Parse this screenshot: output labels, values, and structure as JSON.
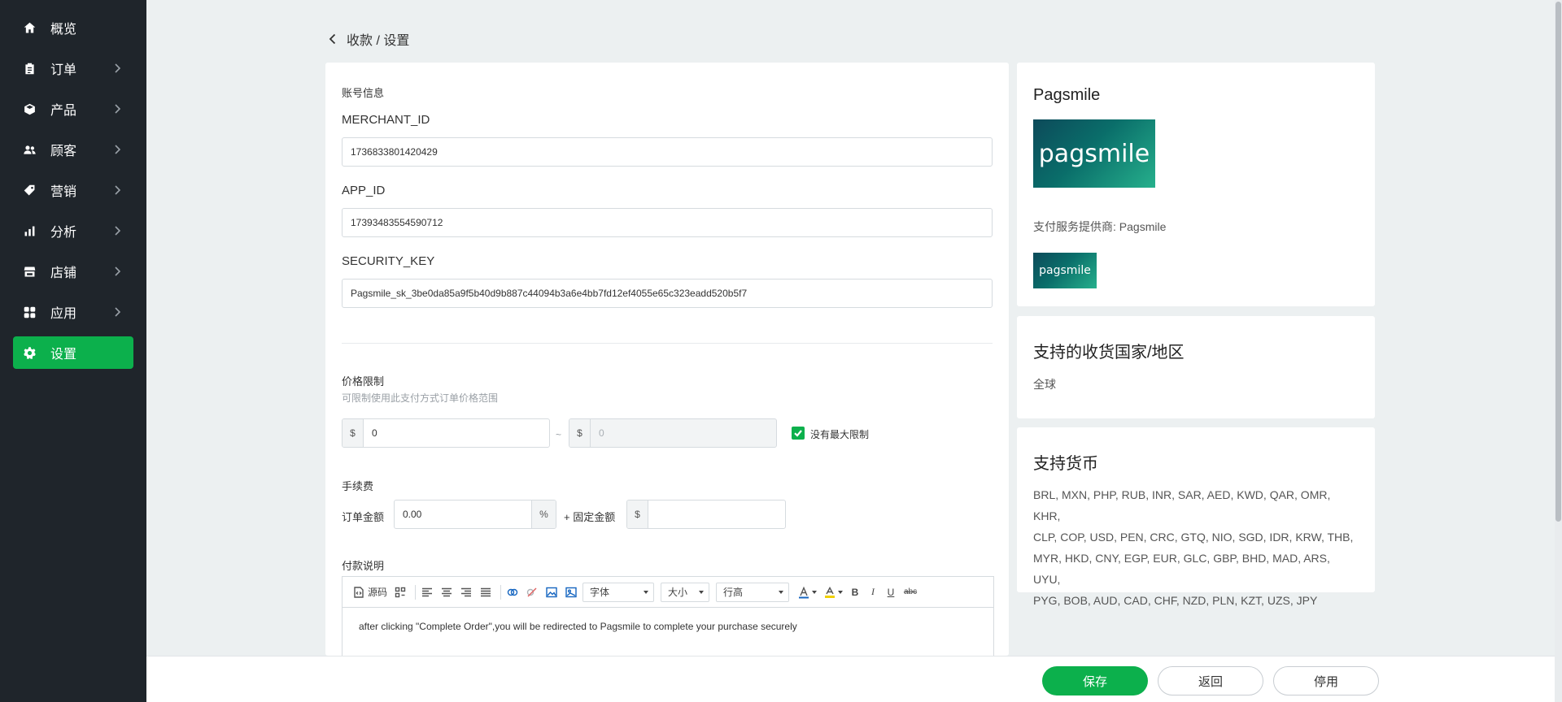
{
  "sidebar": {
    "items": [
      {
        "label": "概览",
        "icon": "home-icon",
        "has_arrow": false
      },
      {
        "label": "订单",
        "icon": "clipboard-icon",
        "has_arrow": true
      },
      {
        "label": "产品",
        "icon": "box-icon",
        "has_arrow": true
      },
      {
        "label": "顾客",
        "icon": "users-icon",
        "has_arrow": true
      },
      {
        "label": "营销",
        "icon": "tag-icon",
        "has_arrow": true
      },
      {
        "label": "分析",
        "icon": "bar-chart-icon",
        "has_arrow": true
      },
      {
        "label": "店铺",
        "icon": "store-icon",
        "has_arrow": true
      },
      {
        "label": "应用",
        "icon": "apps-icon",
        "has_arrow": true
      },
      {
        "label": "设置",
        "icon": "gear-icon",
        "has_arrow": false,
        "active": true
      }
    ]
  },
  "breadcrumb": {
    "text": "收款 / 设置"
  },
  "account": {
    "section_title": "账号信息",
    "merchant_id_label": "MERCHANT_ID",
    "merchant_id_value": "1736833801420429",
    "app_id_label": "APP_ID",
    "app_id_value": "17393483554590712",
    "security_key_label": "SECURITY_KEY",
    "security_key_value": "Pagsmile_sk_3be0da85a9f5b40d9b887c44094b3a6e4bb7fd12ef4055e65c323eadd520b5f7"
  },
  "price_limit": {
    "title": "价格限制",
    "hint": "可限制使用此支付方式订单价格范围",
    "currency_symbol": "$",
    "min_value": "0",
    "separator": "~",
    "max_placeholder": "0",
    "no_max_label": "没有最大限制",
    "no_max_checked": true
  },
  "fee": {
    "title": "手续费",
    "order_amount_label": "订单金额",
    "percent_value": "0.00",
    "percent_symbol": "%",
    "fixed_amount_label": "+ 固定金额",
    "currency_symbol": "$",
    "fixed_value": ""
  },
  "payment_desc": {
    "title": "付款说明",
    "toolbar": {
      "source_label": "源码",
      "font_label": "字体",
      "size_label": "大小",
      "line_height_label": "行高",
      "bold": "B",
      "italic": "I",
      "underline": "U",
      "strike": "abc"
    },
    "content": "after clicking \"Complete Order\",you will be redirected to Pagsmile to complete your purchase securely"
  },
  "provider_card": {
    "title": "Pagsmile",
    "logo_text": "pagsmile",
    "provider_text": "支付服务提供商: Pagsmile",
    "brand_color": "#0a6e6a"
  },
  "regions_card": {
    "title": "支持的收货国家/地区",
    "value": "全球"
  },
  "currency_card": {
    "title": "支持货币",
    "lines": [
      "BRL, MXN, PHP, RUB, INR, SAR, AED, KWD, QAR, OMR, KHR,",
      "CLP, COP, USD, PEN, CRC, GTQ, NIO, SGD, IDR, KRW, THB,",
      "MYR, HKD, CNY, EGP, EUR, GLC, GBP, BHD, MAD, ARS, UYU,",
      "PYG, BOB, AUD, CAD, CHF, NZD, PLN, KZT, UZS, JPY"
    ]
  },
  "footer": {
    "save_label": "保存",
    "back_label": "返回",
    "disable_label": "停用"
  },
  "colors": {
    "accent": "#0cb04c",
    "sidebar_bg": "#1f252b",
    "page_bg": "#ecf0f1"
  }
}
